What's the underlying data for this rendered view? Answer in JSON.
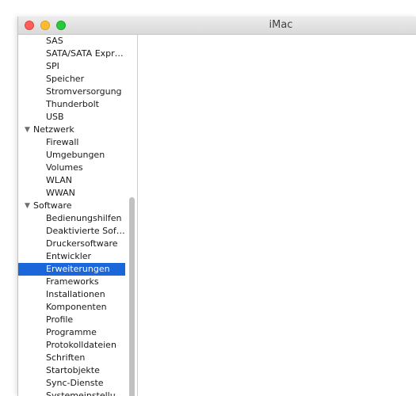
{
  "window": {
    "title": "iMac"
  },
  "sidebar": {
    "items": [
      {
        "label": "SAS",
        "kind": "child"
      },
      {
        "label": "SATA/SATA Expr…",
        "kind": "child"
      },
      {
        "label": "SPI",
        "kind": "child"
      },
      {
        "label": "Speicher",
        "kind": "child"
      },
      {
        "label": "Stromversorgung",
        "kind": "child"
      },
      {
        "label": "Thunderbolt",
        "kind": "child"
      },
      {
        "label": "USB",
        "kind": "child"
      },
      {
        "label": "Netzwerk",
        "kind": "group"
      },
      {
        "label": "Firewall",
        "kind": "child"
      },
      {
        "label": "Umgebungen",
        "kind": "child"
      },
      {
        "label": "Volumes",
        "kind": "child"
      },
      {
        "label": "WLAN",
        "kind": "child"
      },
      {
        "label": "WWAN",
        "kind": "child"
      },
      {
        "label": "Software",
        "kind": "group"
      },
      {
        "label": "Bedienungshilfen",
        "kind": "child"
      },
      {
        "label": "Deaktivierte Sof…",
        "kind": "child"
      },
      {
        "label": "Druckersoftware",
        "kind": "child"
      },
      {
        "label": "Entwickler",
        "kind": "child"
      },
      {
        "label": "Erweiterungen",
        "kind": "child",
        "selected": true
      },
      {
        "label": "Frameworks",
        "kind": "child"
      },
      {
        "label": "Installationen",
        "kind": "child"
      },
      {
        "label": "Komponenten",
        "kind": "child"
      },
      {
        "label": "Profile",
        "kind": "child"
      },
      {
        "label": "Programme",
        "kind": "child"
      },
      {
        "label": "Protokolldateien",
        "kind": "child"
      },
      {
        "label": "Schriften",
        "kind": "child"
      },
      {
        "label": "Startobjekte",
        "kind": "child"
      },
      {
        "label": "Sync-Dienste",
        "kind": "child"
      },
      {
        "label": "Systemeinstellu…",
        "kind": "child"
      }
    ],
    "group_icon": "disclosure-triangle-down-icon"
  },
  "colors": {
    "selection": "#1b66d8",
    "close": "#ff5f57",
    "minimize": "#febc2e",
    "zoom": "#28c840"
  }
}
